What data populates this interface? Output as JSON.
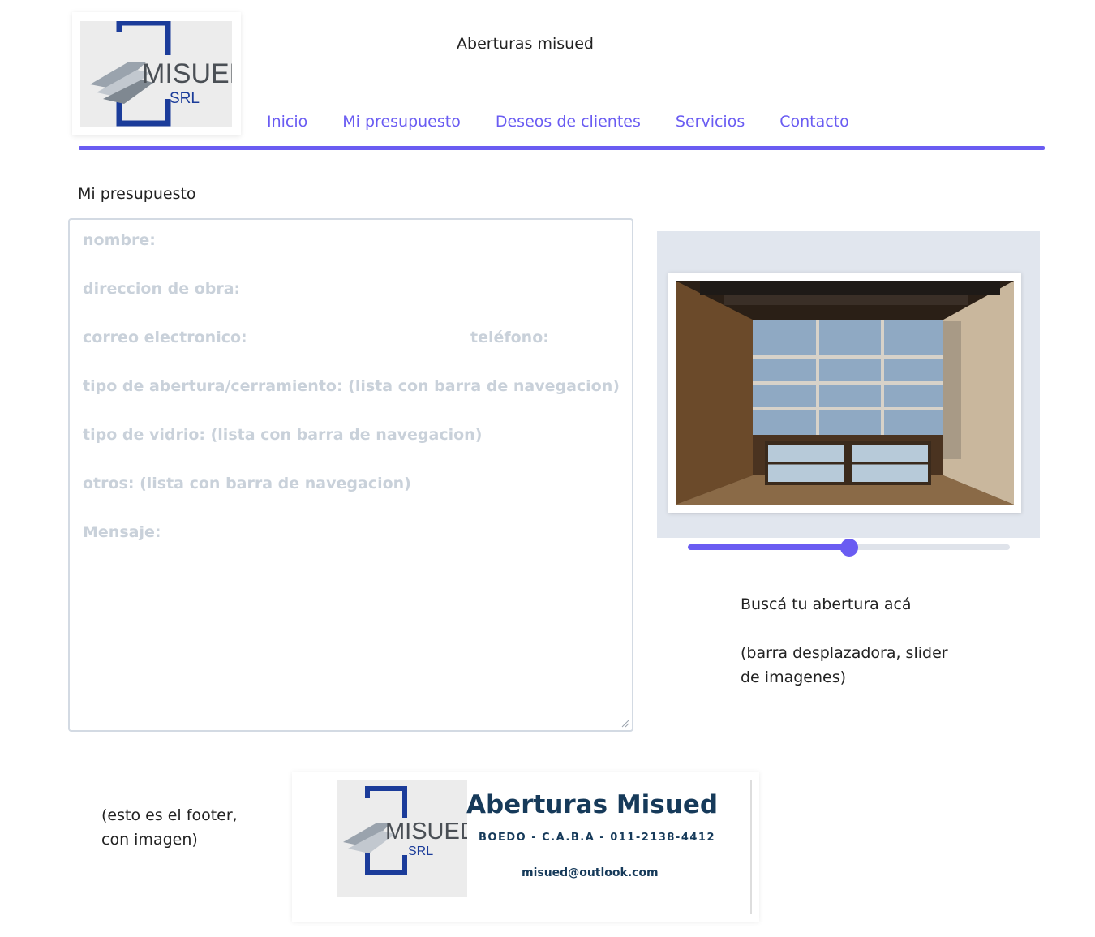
{
  "header": {
    "site_title": "Aberturas misued",
    "logo": {
      "main_text": "MISUED",
      "sub_text": "SRL"
    },
    "nav": [
      "Inicio",
      "Mi presupuesto",
      "Deseos de clientes",
      "Servicios",
      "Contacto"
    ]
  },
  "form": {
    "title": "Mi presupuesto",
    "fields": {
      "nombre": "nombre:",
      "direccion": "direccion de obra:",
      "correo": "correo electronico:",
      "telefono": "teléfono:",
      "abertura": "tipo de abertura/cerramiento: (lista con barra de navegacion)",
      "vidrio": "tipo de vidrio: (lista con barra de navegacion)",
      "otros": "otros: (lista con barra de navegacion)",
      "mensaje": "Mensaje:"
    }
  },
  "slider": {
    "value_fraction": 0.5,
    "caption": "Buscá tu abertura acá",
    "note_line1": "(barra desplazadora, slider",
    "note_line2": "de imagenes)"
  },
  "footer": {
    "note_line1": "(esto es el footer,",
    "note_line2": "con imagen)",
    "brand": "Aberturas Misued",
    "address": "BOEDO - C.A.B.A  - 011-2138-4412",
    "email": "misued@outlook.com",
    "logo": {
      "main_text": "MISUED",
      "sub_text": "SRL"
    }
  },
  "colors": {
    "accent": "#6a5cf2",
    "placeholder": "#c9d1da",
    "brand": "#163a5a"
  }
}
